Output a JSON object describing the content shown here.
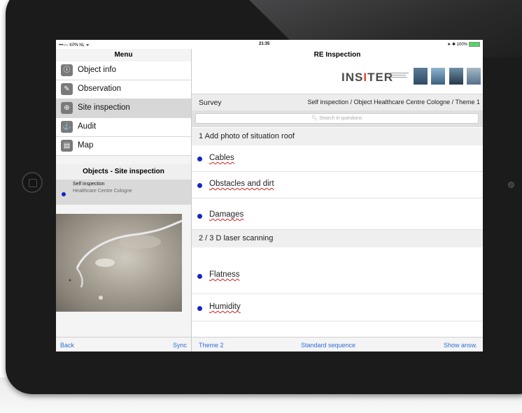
{
  "status_bar": {
    "carrier": "•••○○ KPN NL ᯤ",
    "time": "21:35",
    "battery": "➤ ✱ 100%"
  },
  "sidebar": {
    "title": "Menu",
    "items": [
      {
        "label": "Object info",
        "icon": "object-info-icon",
        "glyph": "ⓘ"
      },
      {
        "label": "Observation",
        "icon": "pencil-icon",
        "glyph": "✎"
      },
      {
        "label": "Site inspection",
        "icon": "zoom-icon",
        "glyph": "⊕"
      },
      {
        "label": "Audit",
        "icon": "audit-icon",
        "glyph": "⚓"
      },
      {
        "label": "Map",
        "icon": "map-icon",
        "glyph": "▤"
      }
    ],
    "objects_header": "Objects - Site inspection",
    "object_line1": "Self inspection",
    "object_line2": "Healthcare Centre Cologne",
    "back_label": "Back",
    "sync_label": "Sync"
  },
  "main": {
    "title": "RE Inspection",
    "logo_prefix": "INS",
    "logo_accent": "I",
    "logo_suffix": "TER",
    "survey_label": "Survey",
    "survey_path": "Self inspection / Object Healthcare Centre Cologne / Theme 1",
    "search_placeholder": "🔍︎ Search in questions",
    "section1": "1 Add photo of situation roof",
    "section1_items": [
      "Cables",
      "Obstacles and dirt",
      "Damages"
    ],
    "section2": "2 / 3 D laser scanning",
    "section2_items": [
      "Flatness",
      "Humidity"
    ],
    "bottom_left": "Theme 2",
    "bottom_center": "Standard sequence",
    "bottom_right": "Show answ."
  },
  "colors": {
    "accent": "#2d6fd9",
    "bullet": "#1524c9",
    "logo_accent": "#e8431c",
    "device": "#1b1b1c"
  }
}
